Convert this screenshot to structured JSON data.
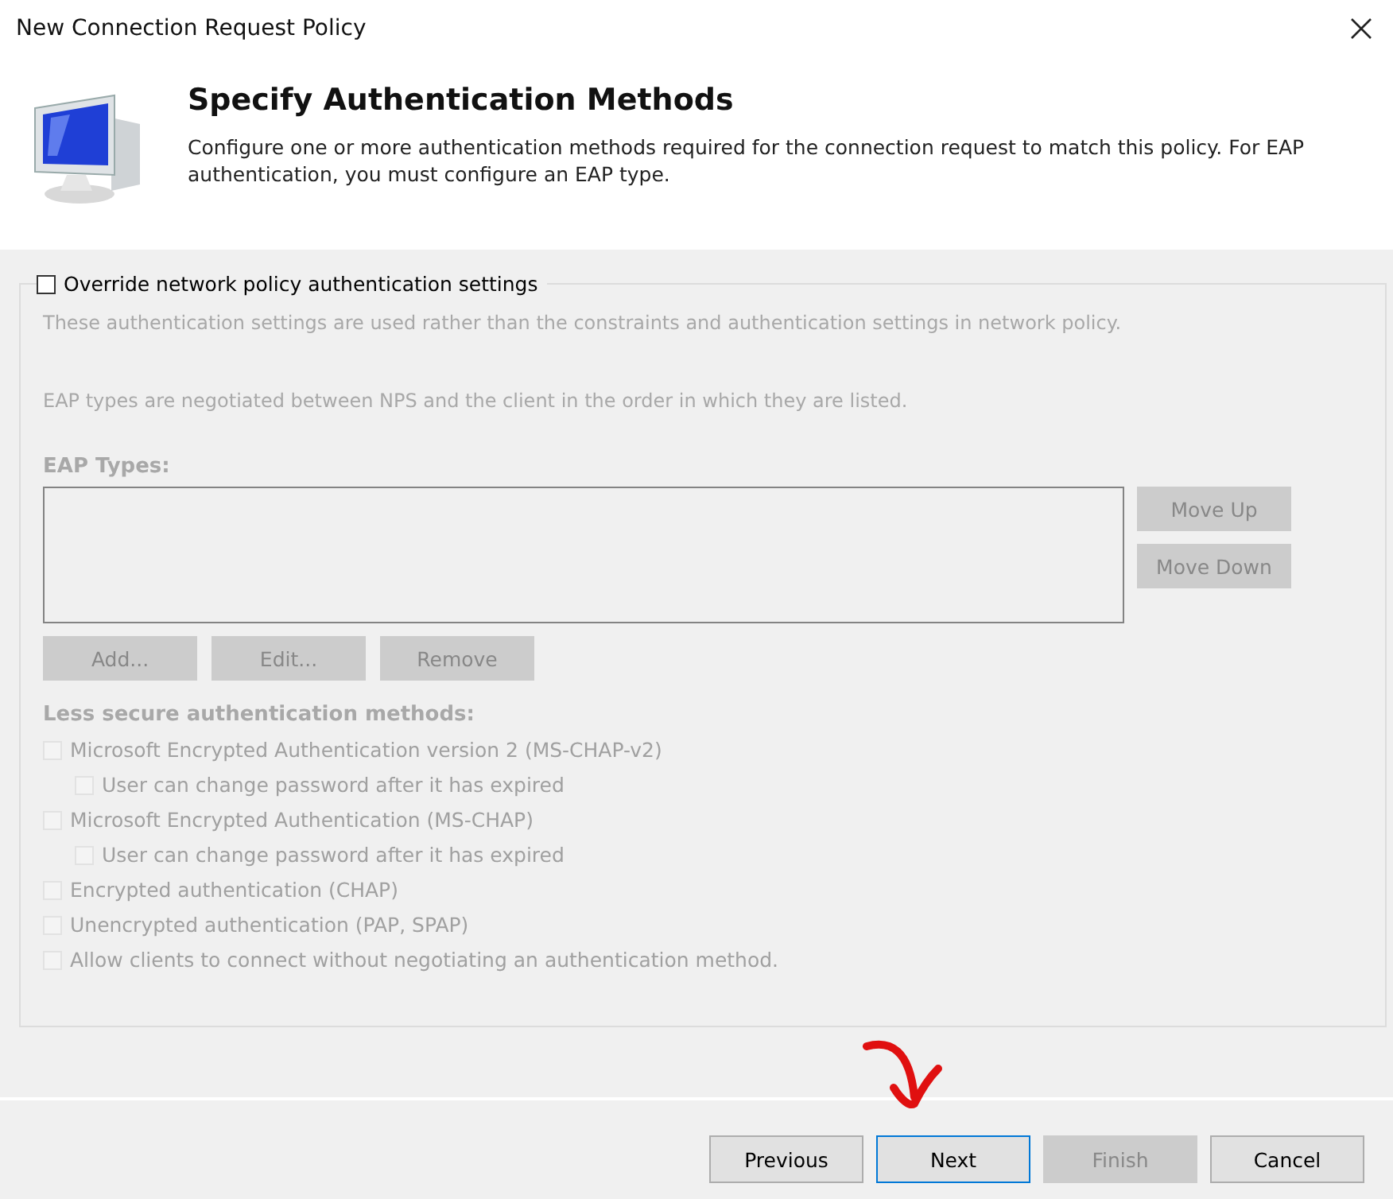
{
  "window": {
    "title": "New Connection Request Policy"
  },
  "header": {
    "title": "Specify Authentication Methods",
    "description": "Configure one or more authentication methods required for the connection request to match this policy. For EAP authentication, you must configure an EAP type."
  },
  "override": {
    "label": "Override network policy authentication settings",
    "checked": false
  },
  "notes": [
    "These authentication settings are used rather than the constraints and authentication settings in network policy.",
    "EAP types are negotiated between NPS and the client in the order in which they are listed."
  ],
  "eap": {
    "label": "EAP Types:",
    "disabled": true,
    "side_buttons": [
      {
        "label": "Move Up",
        "disabled": true
      },
      {
        "label": "Move Down",
        "disabled": true
      }
    ],
    "buttons": [
      {
        "label": "Add...",
        "disabled": true
      },
      {
        "label": "Edit...",
        "disabled": true
      },
      {
        "label": "Remove",
        "disabled": true
      }
    ]
  },
  "less_secure": {
    "label": "Less secure authentication methods:",
    "options": [
      {
        "label": "Microsoft Encrypted Authentication version 2 (MS-CHAP-v2)",
        "checked": false,
        "disabled": true,
        "children": [
          {
            "label": "User can change password after it has expired",
            "checked": false,
            "disabled": true
          }
        ]
      },
      {
        "label": "Microsoft Encrypted Authentication (MS-CHAP)",
        "checked": false,
        "disabled": true,
        "children": [
          {
            "label": "User can change password after it has expired",
            "checked": false,
            "disabled": true
          }
        ]
      },
      {
        "label": "Encrypted authentication (CHAP)",
        "checked": false,
        "disabled": true
      },
      {
        "label": "Unencrypted authentication (PAP, SPAP)",
        "checked": false,
        "disabled": true
      },
      {
        "label": "Allow clients to connect without negotiating an authentication method.",
        "checked": false,
        "disabled": true
      }
    ]
  },
  "footer_buttons": [
    {
      "label": "Previous",
      "disabled": false,
      "focused": false
    },
    {
      "label": "Next",
      "disabled": false,
      "focused": true
    },
    {
      "label": "Finish",
      "disabled": true,
      "focused": false
    },
    {
      "label": "Cancel",
      "disabled": false,
      "focused": false
    }
  ]
}
